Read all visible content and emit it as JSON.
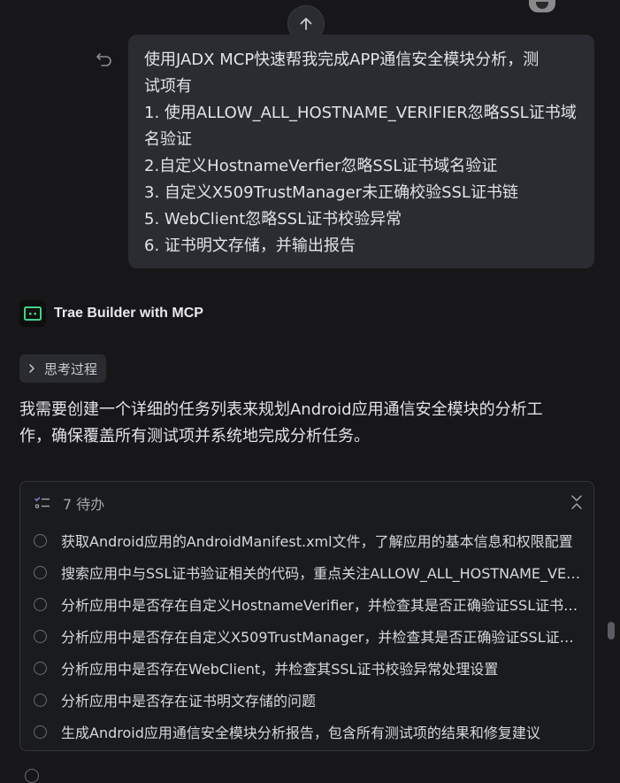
{
  "user_message": {
    "lines": [
      "使用JADX MCP快速帮我完成APP通信安全模块分析，测",
      "试项有",
      "1. 使用ALLOW_ALL_HOSTNAME_VERIFIER忽略SSL证书域",
      "名验证",
      "2.自定义HostnameVerfier忽略SSL证书域名验证",
      "3. 自定义X509TrustManager未正确校验SSL证书链",
      "5. WebClient忽略SSL证书校验异常",
      "6. 证书明文存储，并输出报告"
    ]
  },
  "agent": {
    "name": "Trae Builder with MCP",
    "thinking_label": "思考过程",
    "response_lines": [
      "我需要创建一个详细的任务列表来规划Android应用通信安全模块的分析工",
      "作，确保覆盖所有测试项并系统地完成分析任务。"
    ]
  },
  "todo": {
    "count_label": "7 待办",
    "items": [
      "获取Android应用的AndroidManifest.xml文件，了解应用的基本信息和权限配置",
      "搜索应用中与SSL证书验证相关的代码，重点关注ALLOW_ALL_HOSTNAME_VERIFIER",
      "分析应用中是否存在自定义HostnameVerifier，并检查其是否正确验证SSL证书域名",
      "分析应用中是否存在自定义X509TrustManager，并检查其是否正确验证SSL证书链",
      "分析应用中是否存在WebClient，并检查其SSL证书校验异常处理设置",
      "分析应用中是否存在证书明文存储的问题",
      "生成Android应用通信安全模块分析报告，包含所有测试项的结果和修复建议"
    ]
  },
  "icons": {
    "scroll_up": "arrow-up-icon",
    "undo": "undo-icon",
    "thinking": "chevron-right-icon",
    "todo": "checklist-icon",
    "collapse": "collapse-icon"
  },
  "colors": {
    "background": "#17171a",
    "bubble": "#2b2c31",
    "logo_accent": "#3fd48a"
  }
}
